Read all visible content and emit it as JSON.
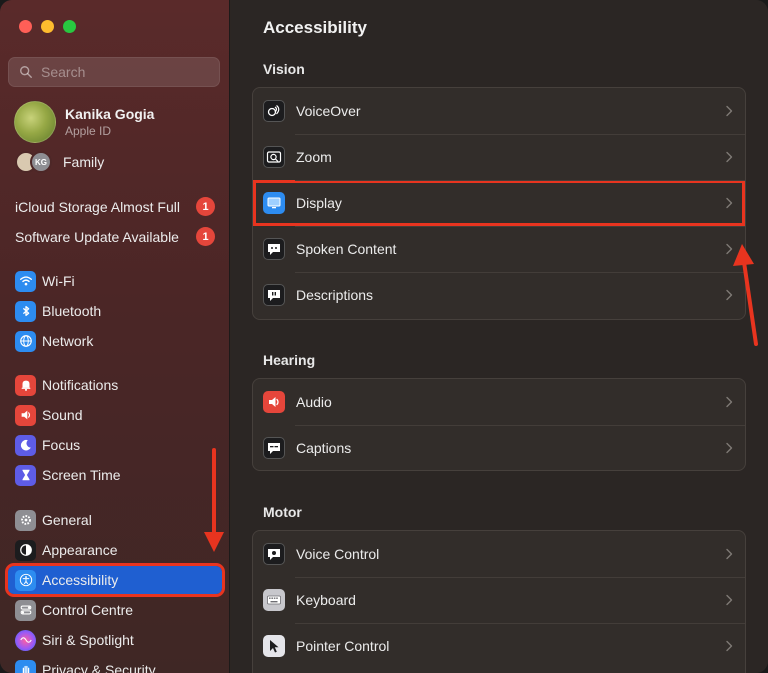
{
  "window": {
    "title": "Accessibility"
  },
  "search": {
    "placeholder": "Search"
  },
  "profile": {
    "name": "Kanika Gogia",
    "subtitle": "Apple ID"
  },
  "family": {
    "label": "Family",
    "initials": "KG"
  },
  "notices": [
    {
      "label": "iCloud Storage Almost Full",
      "badge": "1"
    },
    {
      "label": "Software Update Available",
      "badge": "1"
    }
  ],
  "sidebar": {
    "items": [
      {
        "label": "Wi-Fi",
        "icon": "wifi-icon",
        "color": "#2d8cf0"
      },
      {
        "label": "Bluetooth",
        "icon": "bluetooth-icon",
        "color": "#2d8cf0"
      },
      {
        "label": "Network",
        "icon": "globe-icon",
        "color": "#2d8cf0"
      },
      {
        "label": "Notifications",
        "icon": "bell-icon",
        "color": "#e5463b"
      },
      {
        "label": "Sound",
        "icon": "speaker-icon",
        "color": "#e5463b"
      },
      {
        "label": "Focus",
        "icon": "moon-icon",
        "color": "#5e5ce6"
      },
      {
        "label": "Screen Time",
        "icon": "hourglass-icon",
        "color": "#5e5ce6"
      },
      {
        "label": "General",
        "icon": "gear-icon",
        "color": "#8e8e93"
      },
      {
        "label": "Appearance",
        "icon": "appearance-icon",
        "color": "#1c1c1e"
      },
      {
        "label": "Accessibility",
        "icon": "accessibility-icon",
        "color": "#2d8cf0",
        "selected": true
      },
      {
        "label": "Control Centre",
        "icon": "control-centre-icon",
        "color": "#8e8e93"
      },
      {
        "label": "Siri & Spotlight",
        "icon": "siri-icon",
        "color": "#c040d0"
      },
      {
        "label": "Privacy & Security",
        "icon": "hand-icon",
        "color": "#2d8cf0"
      }
    ]
  },
  "main": {
    "title": "Accessibility",
    "sections": [
      {
        "heading": "Vision",
        "rows": [
          {
            "label": "VoiceOver",
            "icon": "voiceover-icon"
          },
          {
            "label": "Zoom",
            "icon": "zoom-icon"
          },
          {
            "label": "Display",
            "icon": "display-icon",
            "highlighted": true
          },
          {
            "label": "Spoken Content",
            "icon": "spoken-content-icon"
          },
          {
            "label": "Descriptions",
            "icon": "descriptions-icon"
          }
        ]
      },
      {
        "heading": "Hearing",
        "rows": [
          {
            "label": "Audio",
            "icon": "audio-icon"
          },
          {
            "label": "Captions",
            "icon": "captions-icon"
          }
        ]
      },
      {
        "heading": "Motor",
        "rows": [
          {
            "label": "Voice Control",
            "icon": "voice-control-icon"
          },
          {
            "label": "Keyboard",
            "icon": "keyboard-icon"
          },
          {
            "label": "Pointer Control",
            "icon": "pointer-control-icon"
          }
        ]
      }
    ]
  },
  "colors": {
    "accent": "#1f5fd1",
    "annotation": "#e8341f",
    "badge": "#e5463b"
  }
}
